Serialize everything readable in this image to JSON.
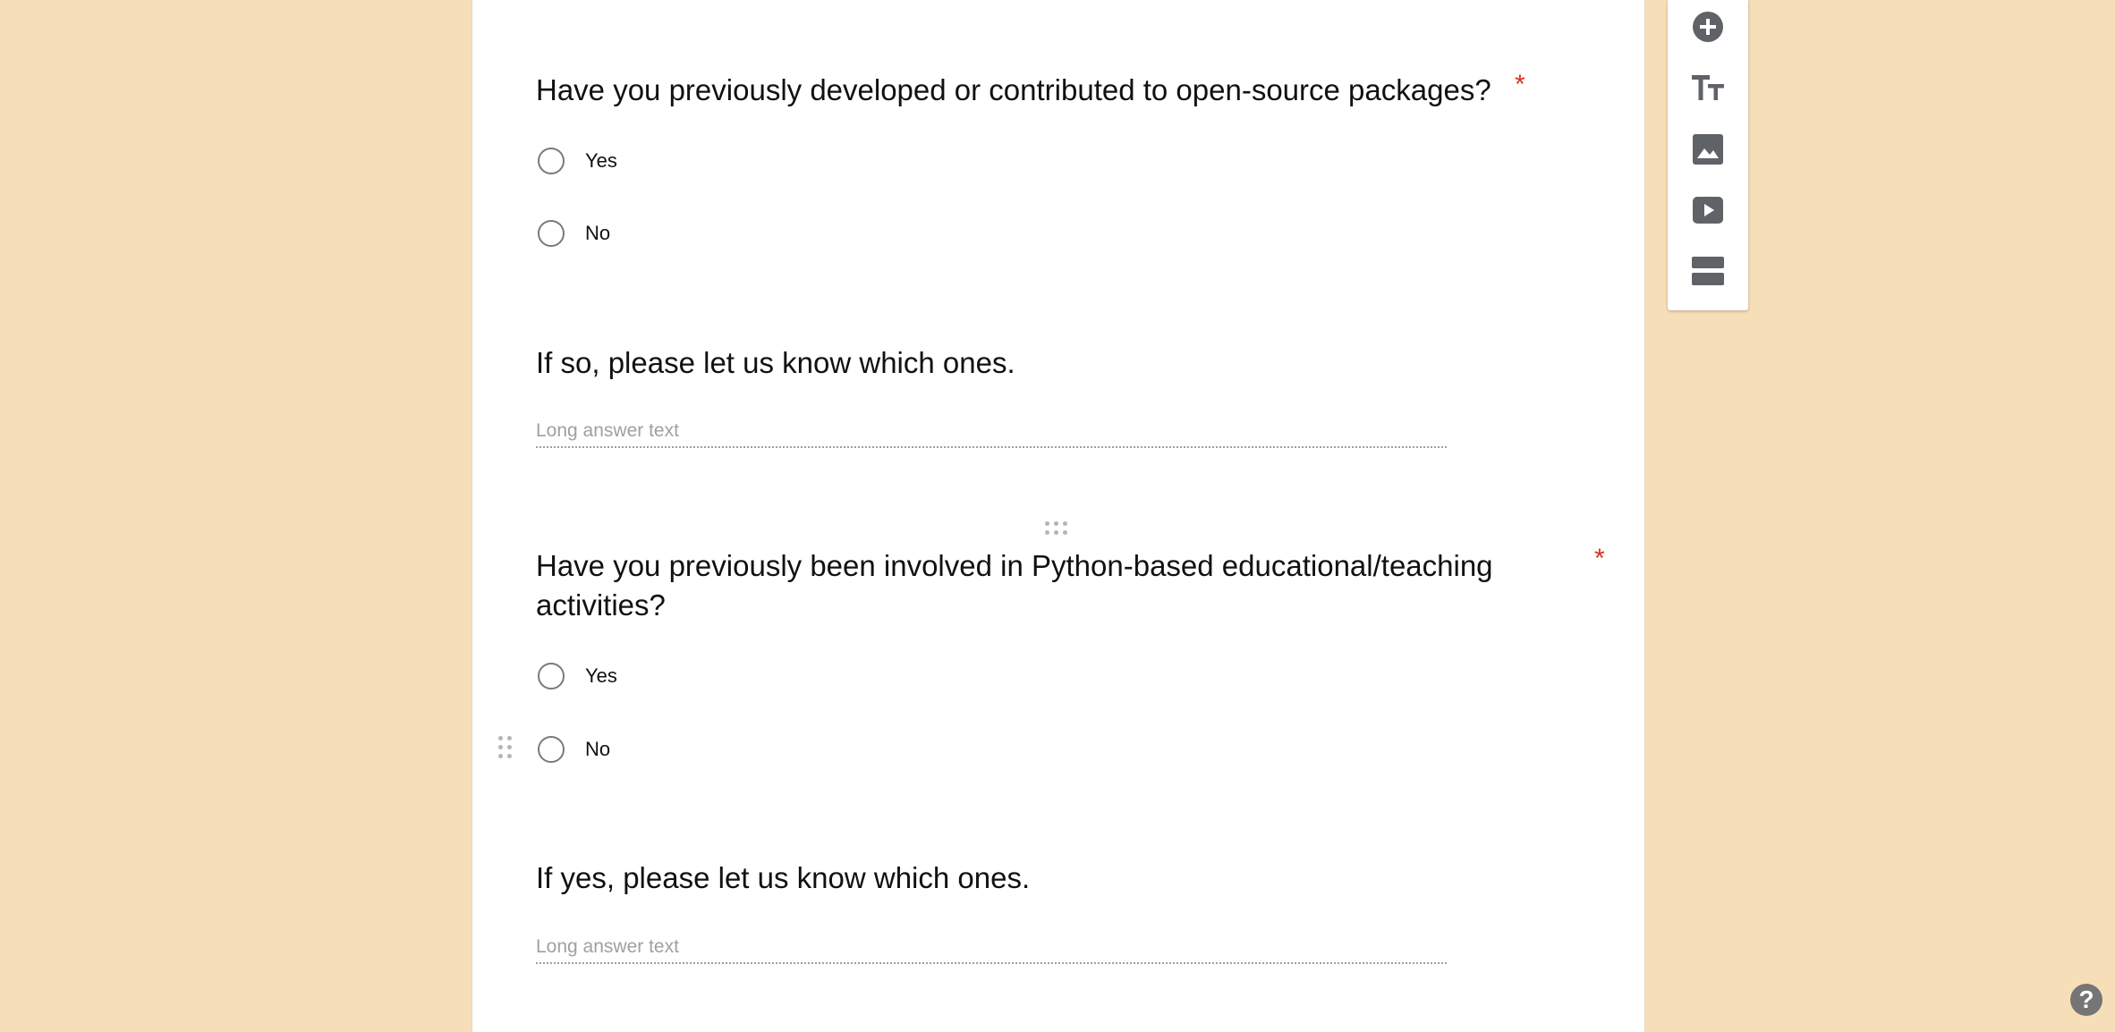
{
  "theme": {
    "background": "#f6dfb8",
    "card": "#ffffff",
    "required_color": "#d93025",
    "icon_color": "#5f6368"
  },
  "questions": [
    {
      "title": "Have you previously developed or contributed to open-source packages?",
      "required_mark": "*",
      "type": "multiple-choice",
      "options": [
        "Yes",
        "No"
      ]
    },
    {
      "title": "If so, please let us know which ones.",
      "type": "paragraph",
      "placeholder": "Long answer text"
    },
    {
      "title_line1": "Have you previously been involved in Python-based educational/teaching",
      "title_line2": "activities?",
      "required_mark": "*",
      "type": "multiple-choice",
      "options": [
        "Yes",
        "No"
      ]
    },
    {
      "title": "If yes, please let us know which ones.",
      "type": "paragraph",
      "placeholder": "Long answer text"
    }
  ],
  "toolbar": {
    "items": [
      {
        "icon": "add-circle-icon",
        "name": "Add question"
      },
      {
        "icon": "title-text-icon",
        "name": "Add title and description"
      },
      {
        "icon": "image-icon",
        "name": "Add image"
      },
      {
        "icon": "video-icon",
        "name": "Add video"
      },
      {
        "icon": "section-icon",
        "name": "Add section"
      }
    ]
  },
  "help": {
    "label": "?"
  }
}
